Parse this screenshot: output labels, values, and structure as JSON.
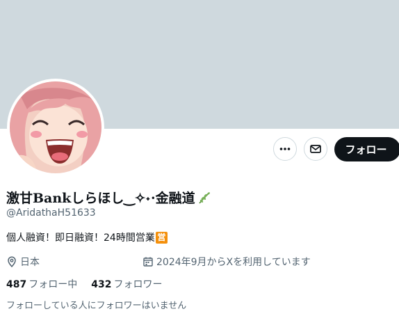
{
  "profile": {
    "display_name": "激甘Bankしらほし‿✧˖·金融道",
    "handle": "@AridathaH51633",
    "bio": "個人融資！即日融資！24時間営業",
    "bio_badge": "営",
    "location": "日本",
    "joined": "2024年9月からXを利用しています",
    "following_count": "487",
    "following_label": "フォロー中",
    "followers_count": "432",
    "followers_label": "フォロワー",
    "followers_note": "フォローしている人にフォロワーはいません"
  },
  "actions": {
    "follow_label": "フォロー",
    "more_icon": "more-icon",
    "message_icon": "mail-icon"
  },
  "colors": {
    "banner": "#cfd9de",
    "follow_button": "#0f1419",
    "secondary_text": "#536471",
    "badge": "#f4900c"
  }
}
